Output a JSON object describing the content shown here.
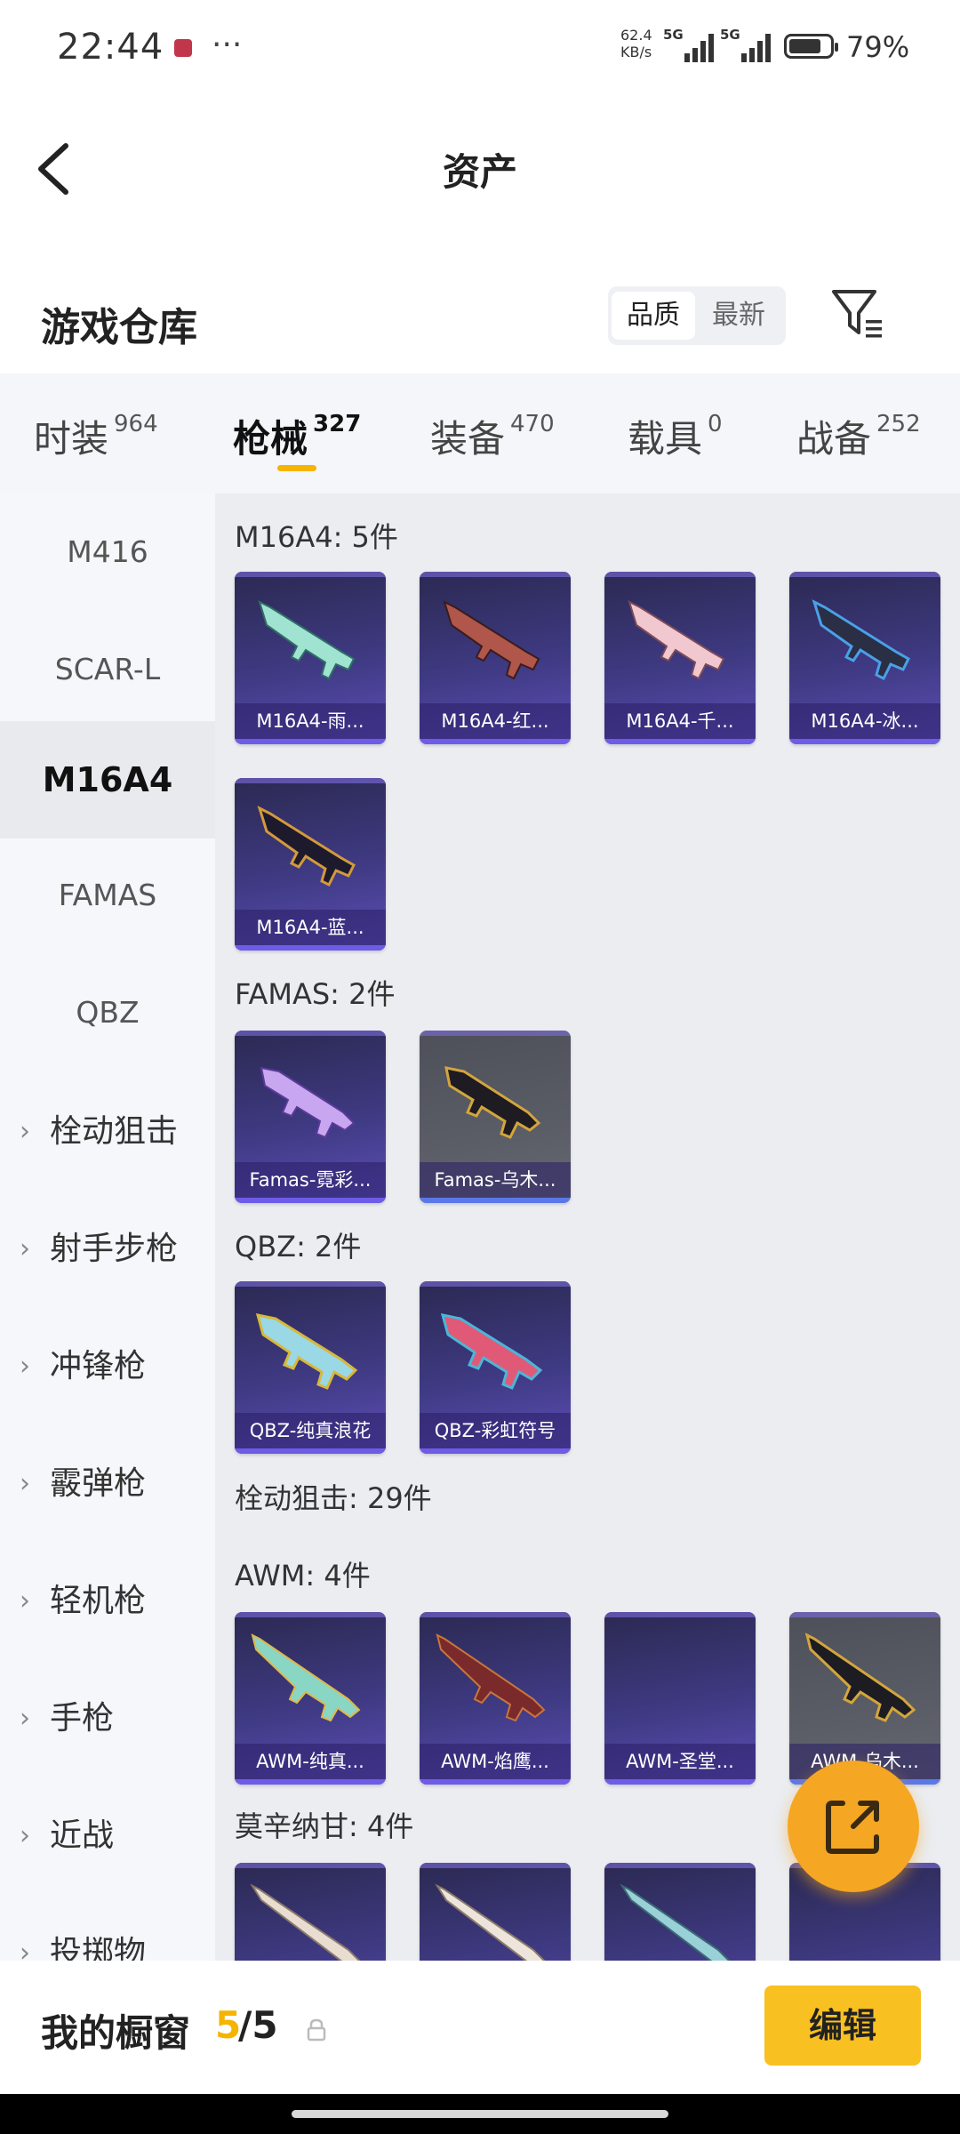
{
  "status_bar": {
    "time": "22:44",
    "more": "···",
    "net_speed_value": "62.4",
    "net_speed_unit": "KB/s",
    "signal1_label": "5G",
    "signal2_label": "5G",
    "battery_percent": "79%",
    "battery_level": 0.79
  },
  "nav": {
    "title": "资产"
  },
  "warehouse": {
    "title": "游戏仓库",
    "sort_options": [
      "品质",
      "最新"
    ]
  },
  "tabs": [
    {
      "label": "时装",
      "count": "964"
    },
    {
      "label": "枪械",
      "count": "327"
    },
    {
      "label": "装备",
      "count": "470"
    },
    {
      "label": "载具",
      "count": "0"
    },
    {
      "label": "战备",
      "count": "252"
    }
  ],
  "sidebar": {
    "items": [
      "M416",
      "SCAR-L",
      "M16A4",
      "FAMAS",
      "QBZ"
    ],
    "categories": [
      "栓动狙击",
      "射手步枪",
      "冲锋枪",
      "霰弹枪",
      "轻机枪",
      "手枪",
      "近战",
      "投掷物"
    ]
  },
  "sections": [
    {
      "title": "M16A4: 5件",
      "items": [
        "M16A4-雨...",
        "M16A4-红...",
        "M16A4-千...",
        "M16A4-冰...",
        "M16A4-蓝..."
      ]
    },
    {
      "title": "FAMAS: 2件",
      "items": [
        "Famas-霓彩...",
        "Famas-乌木..."
      ]
    },
    {
      "title": "QBZ: 2件",
      "items": [
        "QBZ-纯真浪花",
        "QBZ-彩虹符号"
      ]
    },
    {
      "title": "栓动狙击: 29件",
      "items": []
    },
    {
      "title": "AWM: 4件",
      "items": [
        "AWM-纯真...",
        "AWM-焰鹰...",
        "AWM-圣堂...",
        "AWM-乌木..."
      ]
    },
    {
      "title": "莫辛纳甘: 4件",
      "items": []
    }
  ],
  "bottom_bar": {
    "label": "我的橱窗",
    "count_current": "5",
    "count_total": "/5",
    "edit_label": "编辑"
  },
  "colors": {
    "accent": "#f4b400",
    "card_purple": "#3f3a83",
    "card_gray": "#5a5d66",
    "fab": "#f5a623"
  }
}
